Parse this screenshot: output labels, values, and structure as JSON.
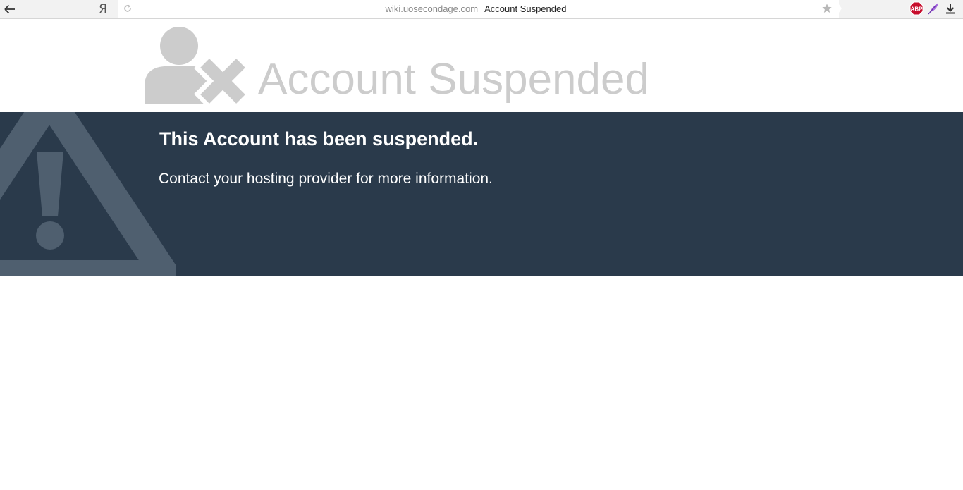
{
  "browser": {
    "back_icon": "arrow-left-icon",
    "home_label": "Я",
    "reload_icon": "reload-icon",
    "url_domain": "wiki.uosecondage.com",
    "page_title": "Account Suspended",
    "bookmark_icon": "star-icon",
    "extensions": [
      {
        "name": "adblock-plus-icon",
        "label": "ABP",
        "color": "#c70d2c"
      },
      {
        "name": "feather-icon",
        "color": "#9b59d6"
      },
      {
        "name": "download-icon"
      }
    ]
  },
  "page": {
    "heading": "Account Suspended",
    "heading_icon": "user-remove-icon",
    "heading_color": "#cccccc",
    "banner": {
      "background": "#2a3a4b",
      "icon": "warning-icon",
      "title": "This Account has been suspended.",
      "message": "Contact your hosting provider for more information."
    }
  }
}
